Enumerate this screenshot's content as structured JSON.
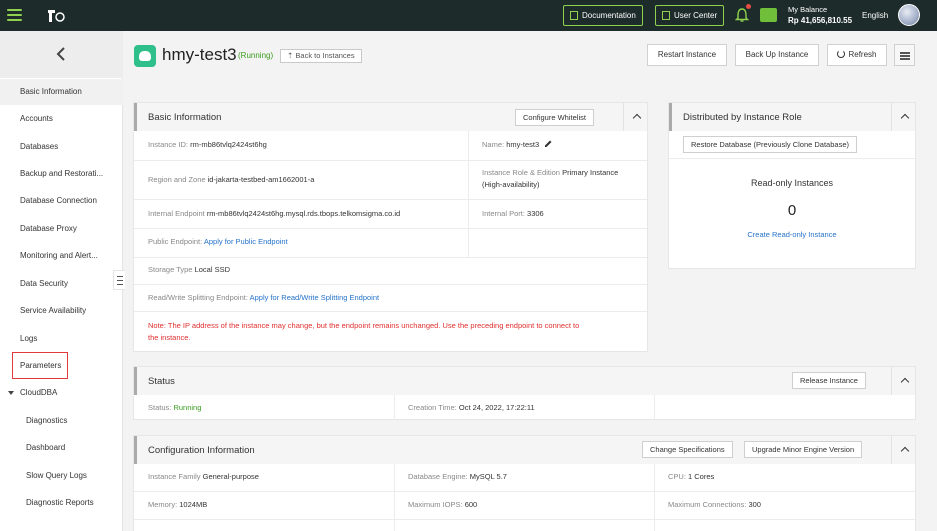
{
  "topbar": {
    "documentation": "Documentation",
    "user_center": "User Center",
    "balance_label": "My Balance",
    "balance_value": "Rp 41,656,810.55",
    "language": "English"
  },
  "sidebar": {
    "items": [
      {
        "label": "Basic Information"
      },
      {
        "label": "Accounts"
      },
      {
        "label": "Databases"
      },
      {
        "label": "Backup and Restorati..."
      },
      {
        "label": "Database Connection"
      },
      {
        "label": "Database Proxy"
      },
      {
        "label": "Monitoring and Alert..."
      },
      {
        "label": "Data Security"
      },
      {
        "label": "Service Availability"
      },
      {
        "label": "Logs"
      },
      {
        "label": "Parameters"
      },
      {
        "label": "CloudDBA"
      },
      {
        "label": "Diagnostics"
      },
      {
        "label": "Dashboard"
      },
      {
        "label": "Slow Query Logs"
      },
      {
        "label": "Diagnostic Reports"
      }
    ]
  },
  "header": {
    "title": "hmy-test3",
    "status": "(Running)",
    "back_label": "Back to Instances",
    "restart": "Restart Instance",
    "backup": "Back Up Instance",
    "refresh": "Refresh"
  },
  "basic": {
    "title": "Basic Information",
    "whitelist_btn": "Configure Whitelist",
    "instance_id_label": "Instance ID:",
    "instance_id": "rm-mb86tvlq2424st6hg",
    "name_label": "Name:",
    "name": "hmy-test3",
    "region_label": "Region and Zone",
    "region": "id-jakarta-testbed-am1662001-a",
    "role_label": "Instance Role & Edition",
    "role": "Primary Instance",
    "role_sub": "(High-availability)",
    "internal_ep_label": "Internal Endpoint",
    "internal_ep": "rm-mb86tvlq2424st6hg.mysql.rds.tbops.telkomsigma.co.id",
    "internal_port_label": "Internal Port:",
    "internal_port": "3306",
    "public_ep_label": "Public Endpoint:",
    "public_ep_link": "Apply for Public Endpoint",
    "storage_label": "Storage Type",
    "storage": "Local SSD",
    "rw_label": "Read/Write Splitting Endpoint:",
    "rw_link": "Apply for Read/Write Splitting Endpoint",
    "note_line1": "Note: The IP address of the instance may change, but the endpoint remains unchanged. Use the preceding endpoint to connect to",
    "note_line2": "the instance."
  },
  "distributed": {
    "title": "Distributed by Instance Role",
    "restore_btn": "Restore Database (Previously Clone Database)",
    "readonly_label": "Read-only Instances",
    "readonly_count": "0",
    "create_link": "Create Read-only Instance"
  },
  "status": {
    "title": "Status",
    "release_btn": "Release Instance",
    "status_label": "Status:",
    "status_value": "Running",
    "creation_label": "Creation Time:",
    "creation_value": "Oct 24, 2022, 17:22:11"
  },
  "config": {
    "title": "Configuration Information",
    "change_btn": "Change Specifications",
    "upgrade_btn": "Upgrade Minor Engine Version",
    "family_label": "Instance Family",
    "family": "General-purpose",
    "engine_label": "Database Engine:",
    "engine": "MySQL 5.7",
    "cpu_label": "CPU:",
    "cpu": "1 Cores",
    "memory_label": "Memory:",
    "memory": "1024MB",
    "iops_label": "Maximum IOPS:",
    "iops": "600",
    "conn_label": "Maximum Connections:",
    "conn": "300"
  },
  "colors": {
    "topbar_bg": "#1d2b2a",
    "accent_green": "#8fd14f",
    "link": "#2673c9",
    "running": "#3a9c1f",
    "note_red": "#e03030"
  }
}
